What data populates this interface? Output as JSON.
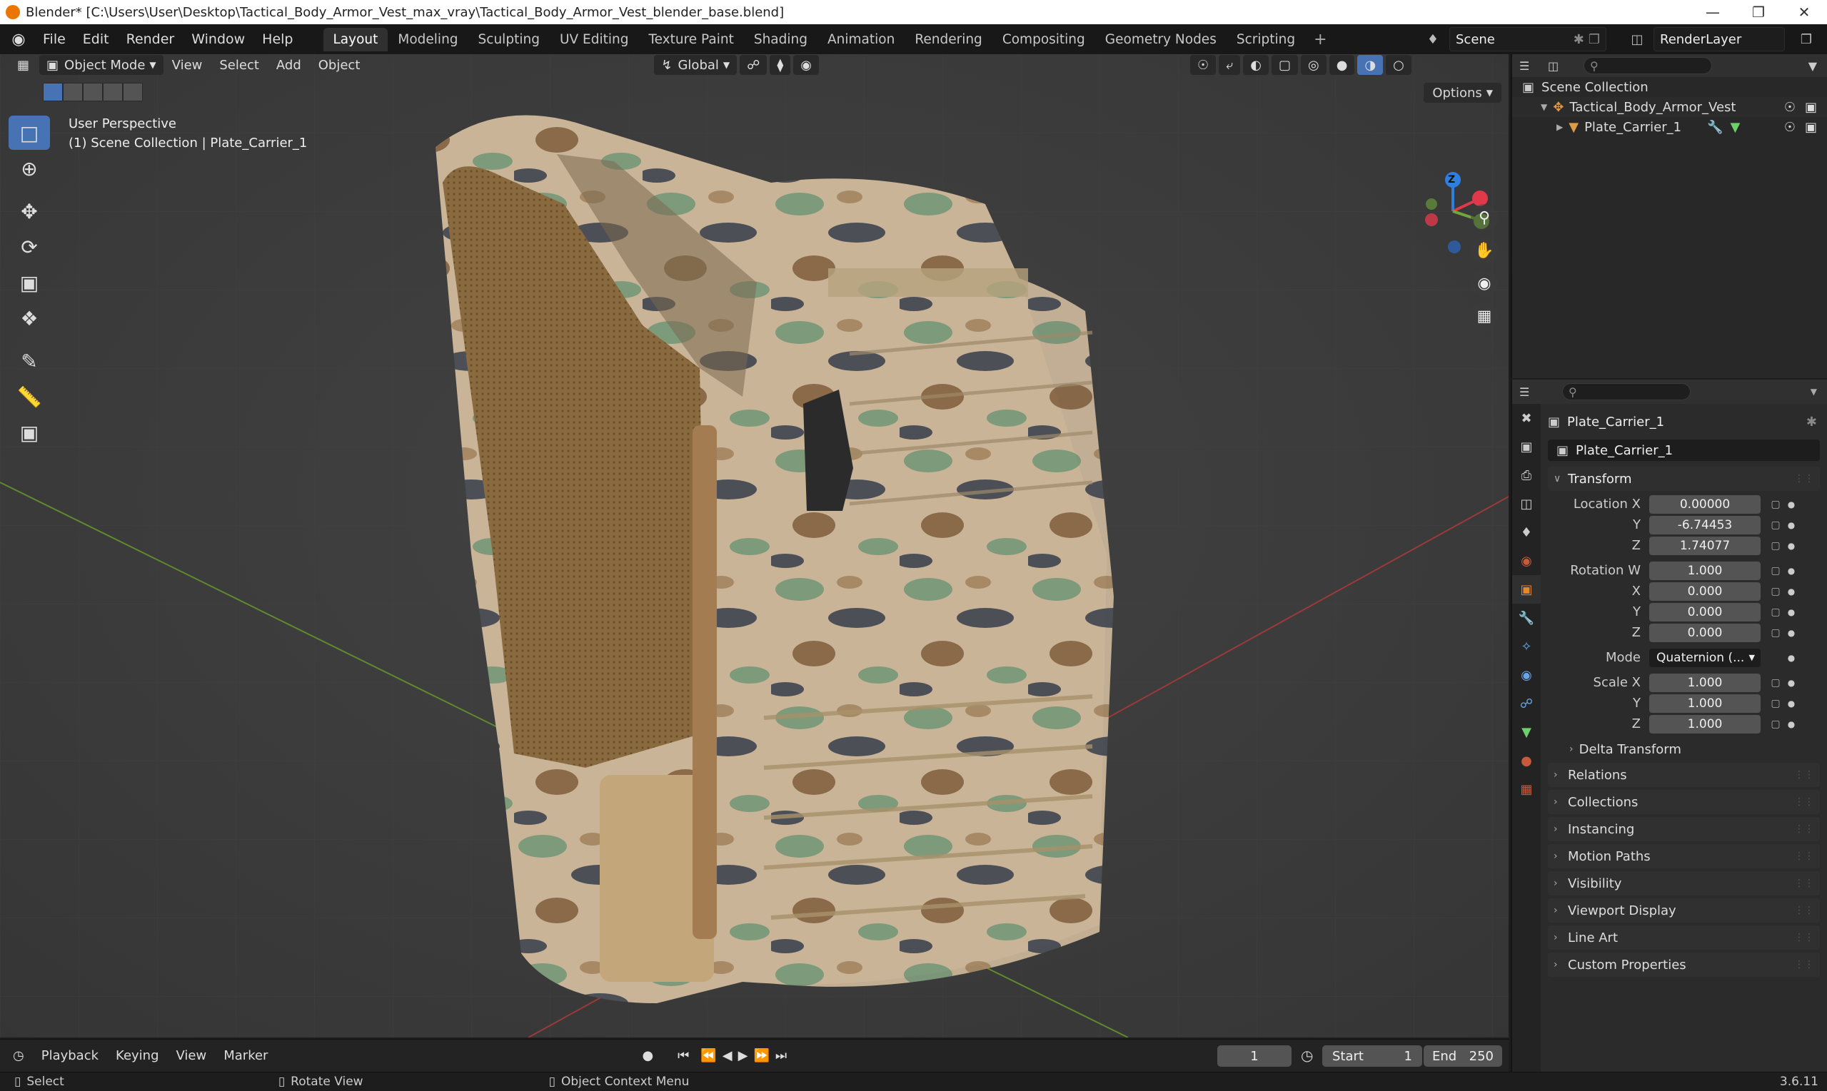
{
  "window": {
    "title": "Blender* [C:\\Users\\User\\Desktop\\Tactical_Body_Armor_Vest_max_vray\\Tactical_Body_Armor_Vest_blender_base.blend]"
  },
  "menu": {
    "items": [
      "File",
      "Edit",
      "Render",
      "Window",
      "Help"
    ]
  },
  "workspaces": {
    "tabs": [
      "Layout",
      "Modeling",
      "Sculpting",
      "UV Editing",
      "Texture Paint",
      "Shading",
      "Animation",
      "Rendering",
      "Compositing",
      "Geometry Nodes",
      "Scripting"
    ],
    "active": "Layout"
  },
  "scene": {
    "name": "Scene"
  },
  "view_layer": {
    "name": "RenderLayer"
  },
  "viewport": {
    "mode": "Object Mode",
    "menus": [
      "View",
      "Select",
      "Add",
      "Object"
    ],
    "orientation": "Global",
    "options_label": "Options",
    "info_line1": "User Perspective",
    "info_line2": "(1) Scene Collection | Plate_Carrier_1",
    "gizmo_axis_label": "Z"
  },
  "outliner": {
    "root": "Scene Collection",
    "items": [
      {
        "name": "Tactical_Body_Armor_Vest"
      },
      {
        "name": "Plate_Carrier_1"
      }
    ]
  },
  "properties": {
    "object_name": "Plate_Carrier_1",
    "data_name": "Plate_Carrier_1",
    "transform_title": "Transform",
    "location": {
      "label": "Location X",
      "x": "0.00000",
      "y": "-6.74453",
      "z": "1.74077"
    },
    "rotation": {
      "label": "Rotation W",
      "w": "1.000",
      "x": "0.000",
      "y": "0.000",
      "z": "0.000"
    },
    "mode": {
      "label": "Mode",
      "value": "Quaternion (..."
    },
    "scale": {
      "label": "Scale X",
      "x": "1.000",
      "y": "1.000",
      "z": "1.000"
    },
    "axis_labels": {
      "x": "X",
      "y": "Y",
      "z": "Z"
    },
    "delta_transform": "Delta Transform",
    "panels": [
      "Relations",
      "Collections",
      "Instancing",
      "Motion Paths",
      "Visibility",
      "Viewport Display",
      "Line Art",
      "Custom Properties"
    ]
  },
  "timeline": {
    "menus": [
      "Playback",
      "Keying",
      "View",
      "Marker"
    ],
    "current_frame": "1",
    "start_label": "Start",
    "start": "1",
    "end_label": "End",
    "end": "250"
  },
  "status": {
    "select": "Select",
    "rotate": "Rotate View",
    "context": "Object Context Menu",
    "version": "3.6.11"
  }
}
